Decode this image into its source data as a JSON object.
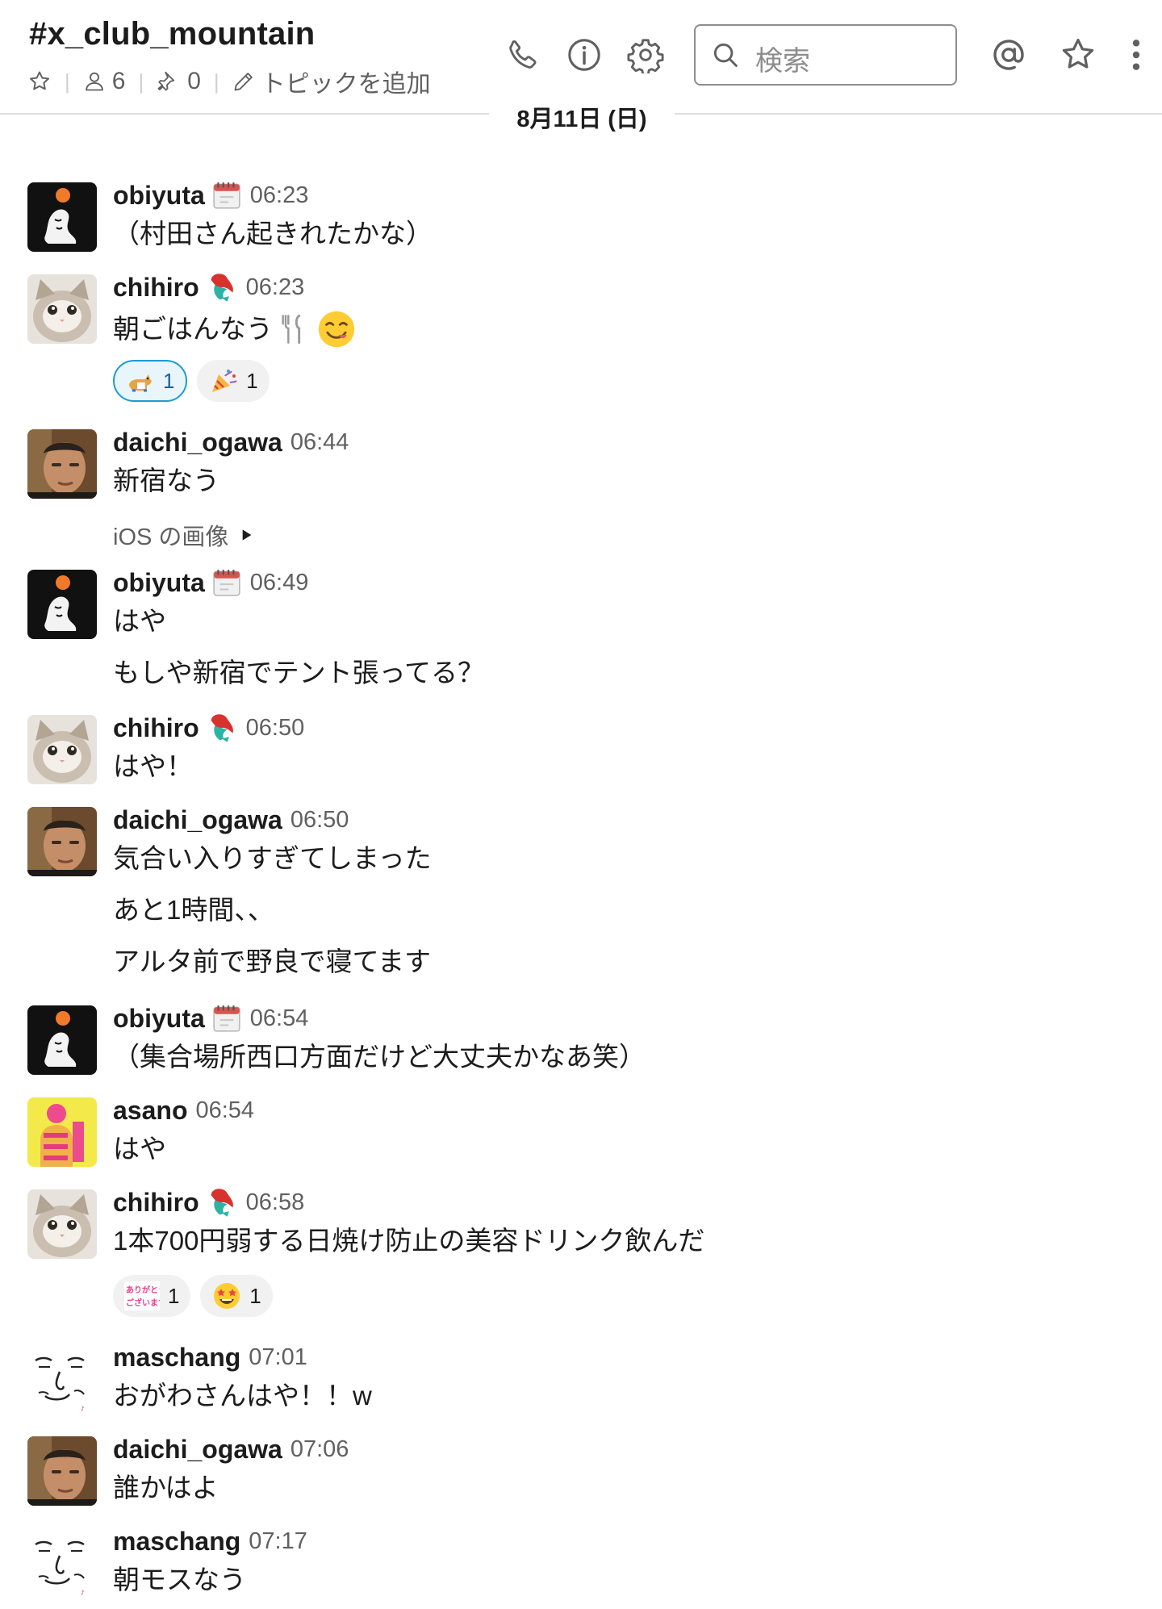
{
  "header": {
    "channel": "#x_club_mountain",
    "members": "6",
    "pins": "0",
    "add_topic": "トピックを追加",
    "search_placeholder": "検索",
    "icons": [
      "star-icon",
      "person-icon",
      "pin-icon",
      "pencil-icon",
      "phone-icon",
      "info-icon",
      "gear-icon",
      "search-icon",
      "at-icon",
      "star-icon",
      "more-icon"
    ]
  },
  "date_divider": "8月11日 (日)",
  "colors": {
    "reaction_highlight": "#1d9bd1",
    "text": "#1d1c1d",
    "muted": "#616061"
  },
  "messages": [
    {
      "user": "obiyuta",
      "status": "calendar",
      "time": "06:23",
      "lines": [
        "（村田さん起きれたかな）"
      ]
    },
    {
      "user": "chihiro",
      "status": "mermaid",
      "time": "06:23",
      "lines": [
        "朝ごはんなう"
      ],
      "inline_emoji": [
        "fork-knife-emoji",
        "yum-face-emoji"
      ],
      "reactions": [
        {
          "emoji": "corgi-emoji",
          "count": "1",
          "mine": true
        },
        {
          "emoji": "party-popper-emoji",
          "count": "1"
        }
      ]
    },
    {
      "user": "daichi_ogawa",
      "time": "06:44",
      "lines": [
        "新宿なう"
      ],
      "attachment": "iOS の画像"
    },
    {
      "user": "obiyuta",
      "status": "calendar",
      "time": "06:49",
      "lines": [
        "はや",
        "もしや新宿でテント張ってる？"
      ]
    },
    {
      "user": "chihiro",
      "status": "mermaid",
      "time": "06:50",
      "lines": [
        "はや！"
      ]
    },
    {
      "user": "daichi_ogawa",
      "time": "06:50",
      "lines": [
        "気合い入りすぎてしまった",
        "あと1時間、、",
        "アルタ前で野良で寝てます"
      ]
    },
    {
      "user": "obiyuta",
      "status": "calendar",
      "time": "06:54",
      "lines": [
        "（集合場所西口方面だけど大丈夫かなあ笑）"
      ]
    },
    {
      "user": "asano",
      "time": "06:54",
      "lines": [
        "はや"
      ]
    },
    {
      "user": "chihiro",
      "status": "mermaid",
      "time": "06:58",
      "lines": [
        "1本700円弱する日焼け防止の美容ドリンク飲んだ"
      ],
      "reactions": [
        {
          "emoji": "arigatou-gozaimasu-emoji",
          "count": "1"
        },
        {
          "emoji": "star-struck-emoji",
          "count": "1"
        }
      ]
    },
    {
      "user": "maschang",
      "time": "07:01",
      "lines": [
        "おがわさんはや！！w"
      ]
    },
    {
      "user": "daichi_ogawa",
      "time": "07:06",
      "lines": [
        "誰かはよ"
      ]
    },
    {
      "user": "maschang",
      "time": "07:17",
      "lines": [
        "朝モスなう"
      ]
    }
  ]
}
